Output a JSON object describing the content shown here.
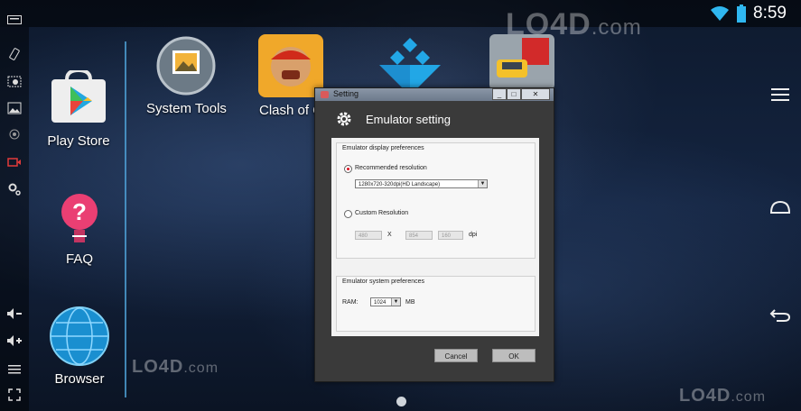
{
  "statusbar": {
    "time": "8:59"
  },
  "watermark": {
    "brand": "LO4D",
    "suffix": ".com"
  },
  "apps": [
    {
      "label": "Play Store"
    },
    {
      "label": "FAQ"
    },
    {
      "label": "Browser"
    },
    {
      "label": "System Tools"
    },
    {
      "label": "Clash of C"
    }
  ],
  "dialog": {
    "window_title": "Setting",
    "heading": "Emulator setting",
    "display_group": {
      "title": "Emulator display preferences",
      "recommended_label": "Recommended resolution",
      "recommended_value": "1280x720-320dpi(HD Landscape)",
      "custom_label": "Custom Resolution",
      "width_value": "480",
      "x_sep": "X",
      "height_value": "854",
      "dpi_value": "160",
      "dpi_label": "dpi"
    },
    "system_group": {
      "title": "Emulator system preferences",
      "ram_label": "RAM:",
      "ram_value": "1024",
      "ram_unit": "MB"
    },
    "cancel_label": "Cancel",
    "ok_label": "OK"
  }
}
